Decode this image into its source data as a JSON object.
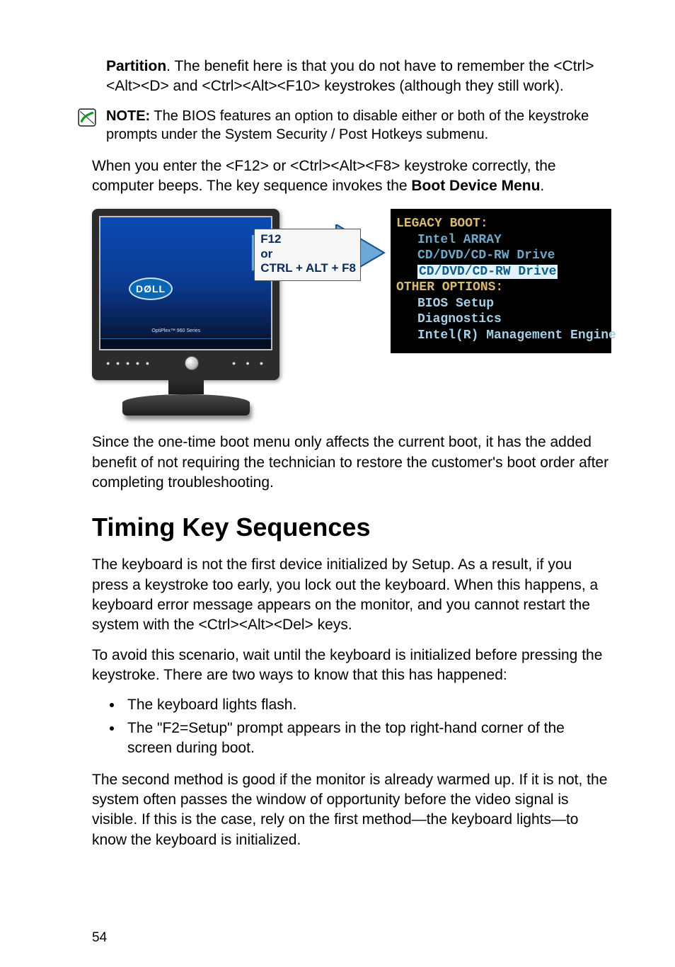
{
  "intro": {
    "partition_label": "Partition",
    "partition_text_rest": ". The benefit here is that you do not have to remember the <Ctrl><Alt><D> and <Ctrl><Alt><F10> keystrokes (although they still work).",
    "note_label": "NOTE:",
    "note_text": " The BIOS features an option to disable either or both of the keystroke prompts under the System Security / Post Hotkeys submenu.",
    "enter_line_pre": "When you enter the <F12> or <Ctrl><Alt><F8> keystroke correctly, the computer beeps. The key sequence invokes the ",
    "enter_line_bold": "Boot Device Menu",
    "enter_line_post": "."
  },
  "figure": {
    "dell_logo": "DØLL",
    "screen_small": "OptiPlex™ 960 Series",
    "key_f12": "F12",
    "key_or": "or",
    "key_combo": "CTRL + ALT + F8",
    "boot_menu": {
      "legacy_title": "LEGACY BOOT:",
      "item1": "Intel ARRAY",
      "item2": "CD/DVD/CD-RW Drive",
      "item3_hl": "CD/DVD/CD-RW Drive",
      "other_title": "OTHER OPTIONS:",
      "opt1": "BIOS Setup",
      "opt2": "Diagnostics",
      "opt3": "Intel(R) Management Engine"
    }
  },
  "after_figure_para": "Since the one-time boot menu only affects the current boot, it has the added benefit of not requiring the technician to restore the customer's boot order after completing troubleshooting.",
  "section_heading": "Timing Key Sequences",
  "timing_para1": "The keyboard is not the first device initialized by Setup. As a result, if you press a keystroke too early, you lock out the keyboard. When this happens, a keyboard error message appears on the monitor, and you cannot restart the system with the <Ctrl><Alt><Del> keys.",
  "timing_para2": "To avoid this scenario, wait until the keyboard is initialized before pressing the keystroke. There are two ways to know that this has happened:",
  "bullets": [
    "The keyboard lights flash.",
    "The \"F2=Setup\" prompt appears in the top right-hand corner of the screen during boot."
  ],
  "timing_para3": "The second method is good if the monitor is already warmed up. If it is not, the system often passes the window of opportunity before the video signal is visible. If this is the case, rely on the first method—the keyboard lights—to know the keyboard is initialized.",
  "page_number": "54"
}
